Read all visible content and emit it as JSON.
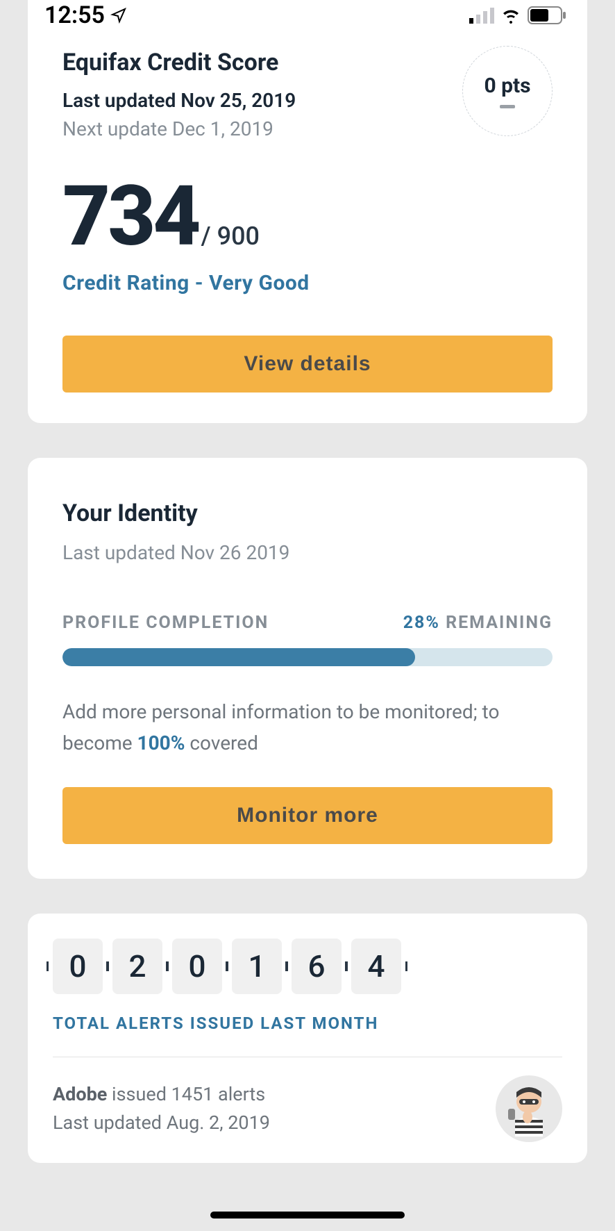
{
  "statusBar": {
    "time": "12:55"
  },
  "creditScore": {
    "title": "Equifax Credit Score",
    "lastUpdated": "Last updated Nov 25, 2019",
    "nextUpdate": "Next update Dec 1, 2019",
    "pointsChange": "0 pts",
    "score": "734",
    "scoreMax": "/ 900",
    "rating": "Credit Rating - Very Good",
    "button": "View details"
  },
  "identity": {
    "title": "Your Identity",
    "lastUpdated": "Last updated Nov 26 2019",
    "completionLabel": "PROFILE COMPLETION",
    "remainingPct": "28%",
    "remainingLabel": " REMAINING",
    "progressWidth": "72%",
    "descPrefix": "Add more personal information to be monitored; to become ",
    "descPct": "100%",
    "descSuffix": " covered",
    "button": "Monitor more"
  },
  "alerts": {
    "digits": [
      "0",
      "2",
      "0",
      "1",
      "6",
      "4"
    ],
    "label": "TOTAL ALERTS ISSUED LAST MONTH",
    "company": "Adobe",
    "issuedText": " issued 1451 alerts",
    "updatedText": "Last updated Aug. 2, 2019"
  }
}
